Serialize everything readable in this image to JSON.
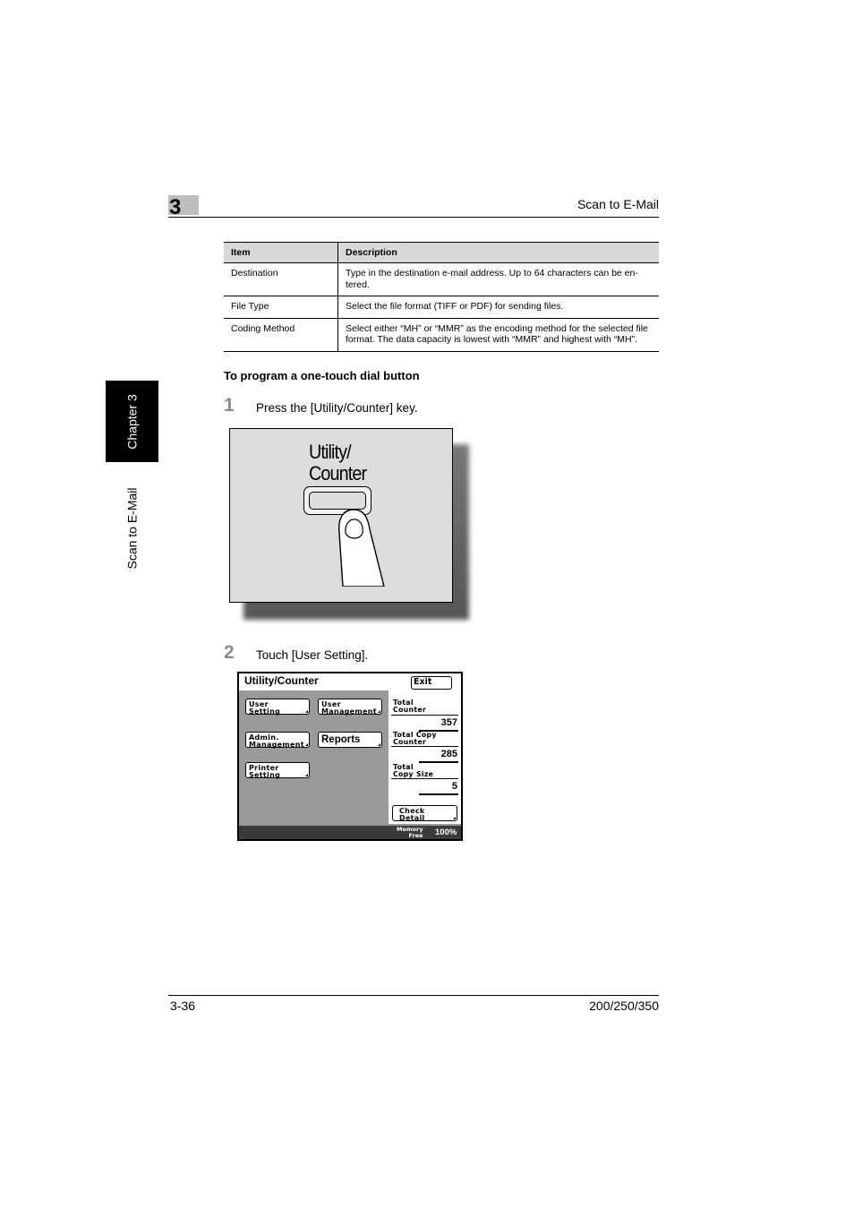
{
  "header": {
    "chapter_number": "3",
    "section_title": "Scan to E-Mail"
  },
  "side_tab": {
    "chapter_label": "Chapter 3",
    "section_label": "Scan to E-Mail"
  },
  "table": {
    "columns": [
      "Item",
      "Description"
    ],
    "rows": [
      {
        "item": "Destination",
        "description": "Type in the destination e-mail address. Up to 64 characters can be en-tered."
      },
      {
        "item": "File Type",
        "description": "Select the file format (TIFF or PDF) for sending files."
      },
      {
        "item": "Coding Method",
        "description": "Select either “MH” or “MMR” as the encoding method for the selected file format. The data capacity is lowest with “MMR” and highest with “MH”."
      }
    ]
  },
  "procedure": {
    "title": "To program a one-touch dial button",
    "steps": [
      {
        "number": "1",
        "text": "Press the [Utility/Counter] key."
      },
      {
        "number": "2",
        "text": "Touch [User Setting]."
      }
    ]
  },
  "key_illustration": {
    "label_line1": "Utility/",
    "label_line2": "Counter",
    "icon": "finger-press-icon"
  },
  "panel": {
    "title": "Utility/Counter",
    "exit_label": "Exit",
    "buttons": [
      {
        "line1": "User",
        "line2": "Setting"
      },
      {
        "line1": "User",
        "line2": "Management"
      },
      {
        "line1": "Admin.",
        "line2": "Management"
      },
      {
        "line1": "Reports",
        "line2": ""
      },
      {
        "line1": "Printer",
        "line2": "Setting"
      }
    ],
    "counters": [
      {
        "line1": "Total",
        "line2": "Counter",
        "value": "357"
      },
      {
        "line1": "Total Copy",
        "line2": "Counter",
        "value": "285"
      },
      {
        "line1": "Total",
        "line2": "Copy Size",
        "value": "5"
      }
    ],
    "check_detail": {
      "line1": "Check",
      "line2": "Detail"
    },
    "memory": {
      "label_line1": "Memory",
      "label_line2": "Free",
      "value": "100%"
    }
  },
  "footer": {
    "page_number": "3-36",
    "model": "200/250/350"
  }
}
